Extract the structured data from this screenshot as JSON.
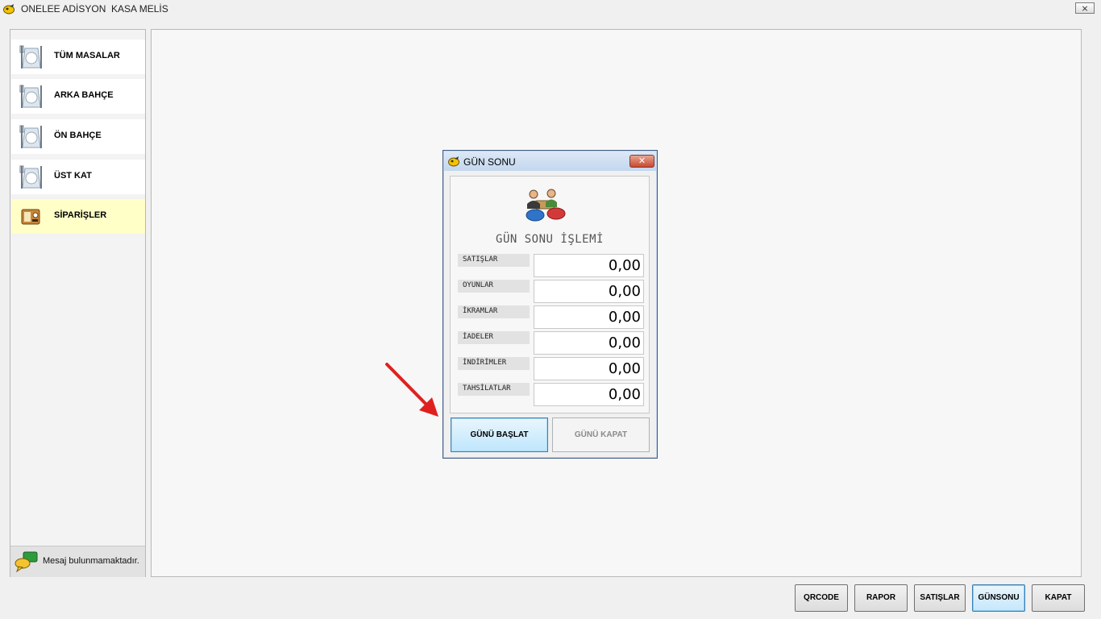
{
  "window": {
    "title": "ONELEE ADİSYON  KASA MELİS",
    "close_symbol": "⨯"
  },
  "sidebar": {
    "items": [
      {
        "label": "TÜM MASALAR",
        "icon": "table-setting-icon",
        "active": false
      },
      {
        "label": "ARKA BAHÇE",
        "icon": "table-setting-icon",
        "active": false
      },
      {
        "label": "ÖN BAHÇE",
        "icon": "table-setting-icon",
        "active": false
      },
      {
        "label": "ÜST KAT",
        "icon": "table-setting-icon",
        "active": false
      },
      {
        "label": "SİPARİŞLER",
        "icon": "orders-icon",
        "active": true
      }
    ],
    "message": {
      "text": "Mesaj bulunmamaktadır.",
      "icon": "chat-bubbles-icon"
    }
  },
  "dialog": {
    "title": "GÜN SONU",
    "close_symbol": "✕",
    "heading": "GÜN SONU İŞLEMİ",
    "rows": [
      {
        "label": "SATIŞLAR",
        "value": "0,00"
      },
      {
        "label": "OYUNLAR",
        "value": "0,00"
      },
      {
        "label": "İKRAMLAR",
        "value": "0,00"
      },
      {
        "label": "İADELER",
        "value": "0,00"
      },
      {
        "label": "İNDİRİMLER",
        "value": "0,00"
      },
      {
        "label": "TAHSİLATLAR",
        "value": "0,00"
      }
    ],
    "start_button": "GÜNÜ BAŞLAT",
    "end_button": "GÜNÜ KAPAT"
  },
  "toolbar": {
    "buttons": [
      {
        "label": "QRCODE",
        "selected": false
      },
      {
        "label": "RAPOR",
        "selected": false
      },
      {
        "label": "SATIŞLAR",
        "selected": false
      },
      {
        "label": "GÜNSONU",
        "selected": true
      },
      {
        "label": "KAPAT",
        "selected": false
      }
    ]
  },
  "colors": {
    "active_item": "#ffffc7",
    "arrow": "#e02020",
    "selected_button_border": "#3c7fb1"
  }
}
